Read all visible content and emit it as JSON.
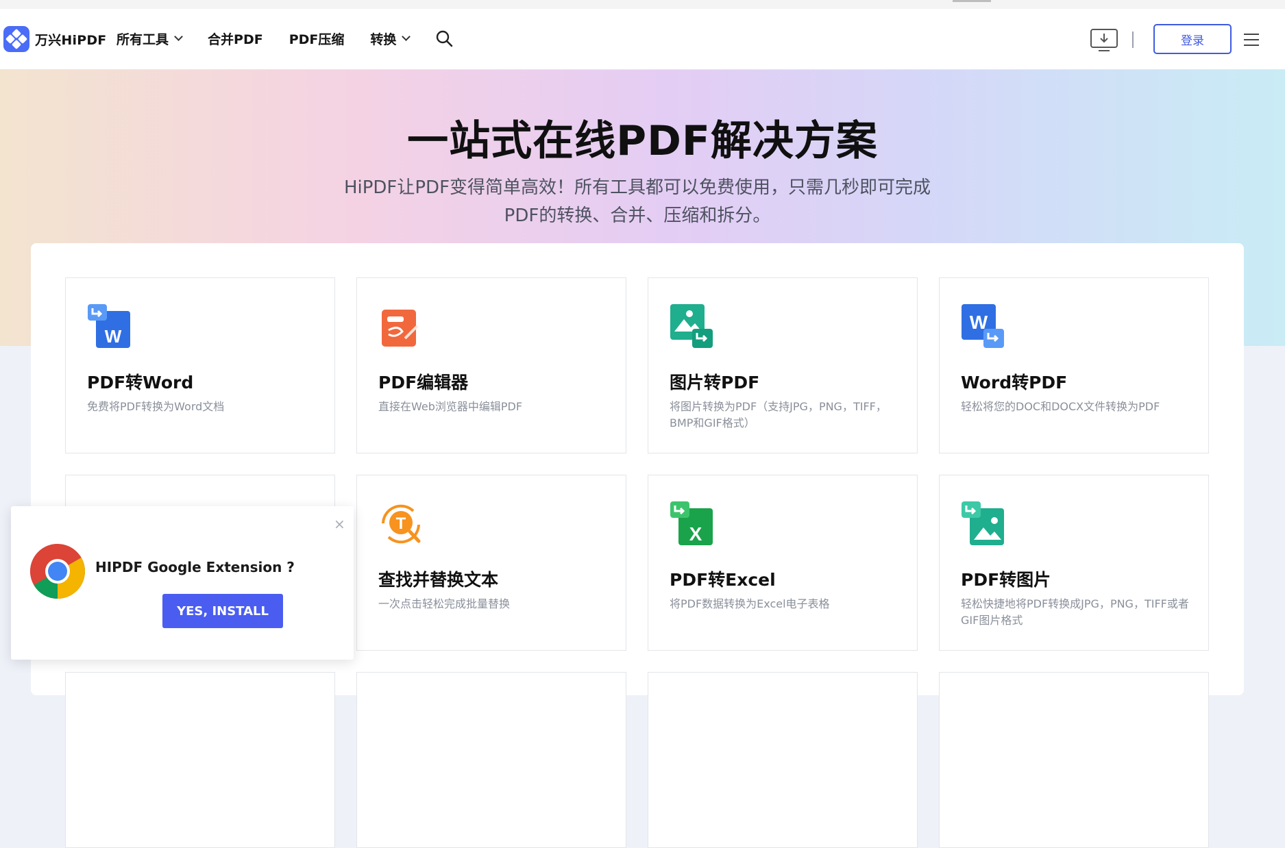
{
  "header": {
    "logo_text": "万兴HiPDF",
    "nav": [
      {
        "label": "所有工具",
        "has_dropdown": true
      },
      {
        "label": "合并PDF",
        "has_dropdown": false
      },
      {
        "label": "PDF压缩",
        "has_dropdown": false
      },
      {
        "label": "转换",
        "has_dropdown": true
      }
    ],
    "icons": {
      "search": "search-icon",
      "download": "download-icon",
      "menu": "menu-icon"
    },
    "login_label": "登录",
    "accent_color": "#3e5be0"
  },
  "hero": {
    "title": "一站式在线PDF解决方案",
    "subtitle_line1": "HiPDF让PDF变得简单高效！所有工具都可以免费使用，只需几秒即可完成",
    "subtitle_line2": "PDF的转换、合并、压缩和拆分。"
  },
  "tools": [
    {
      "title": "PDF转Word",
      "desc": "免费将PDF转换为Word文档",
      "icon": "pdf-to-word-icon"
    },
    {
      "title": "PDF编辑器",
      "desc": "直接在Web浏览器中编辑PDF",
      "icon": "pdf-editor-icon"
    },
    {
      "title": "图片转PDF",
      "desc": "将图片转换为PDF（支持JPG，PNG，TIFF，BMP和GIF格式）",
      "icon": "image-to-pdf-icon"
    },
    {
      "title": "Word转PDF",
      "desc": "轻松将您的DOC和DOCX文件转换为PDF",
      "icon": "word-to-pdf-icon"
    },
    {
      "title": "",
      "desc": "",
      "icon": "purple-tool-icon"
    },
    {
      "title": "查找并替换文本",
      "desc": "一次点击轻松完成批量替换",
      "icon": "find-replace-icon"
    },
    {
      "title": "PDF转Excel",
      "desc": "将PDF数据转换为Excel电子表格",
      "icon": "pdf-to-excel-icon"
    },
    {
      "title": "PDF转图片",
      "desc": "轻松快捷地将PDF转换成JPG，PNG，TIFF或者GIF图片格式",
      "icon": "pdf-to-image-icon"
    }
  ],
  "extension_popup": {
    "title": "HIPDF Google Extension ?",
    "install_label": "YES, INSTALL",
    "close_symbol": "×",
    "icon": "chrome-icon",
    "button_color": "#4a5df0"
  }
}
